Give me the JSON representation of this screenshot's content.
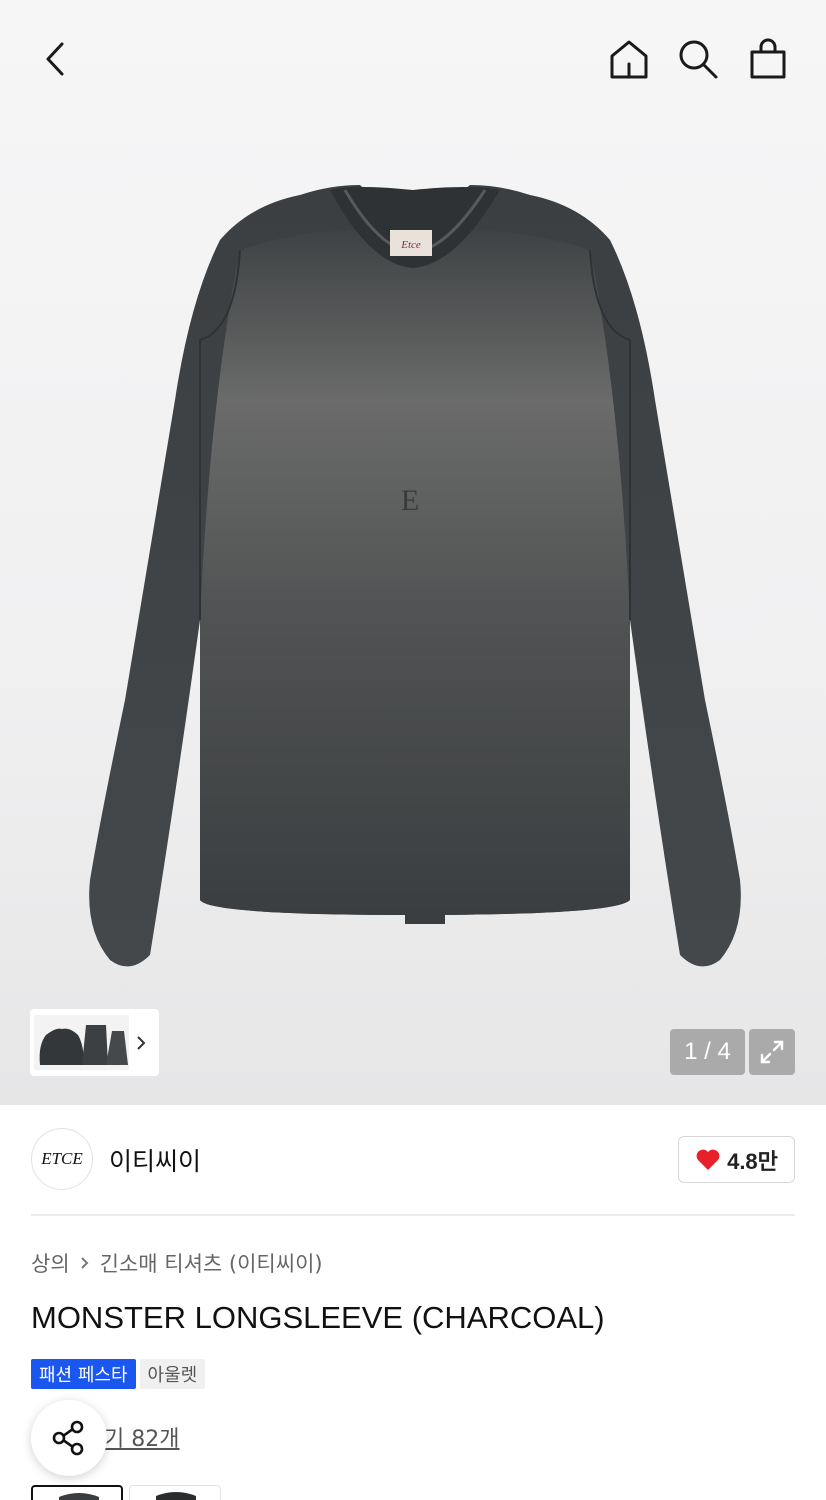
{
  "header": {
    "back_icon": "chevron-left-icon",
    "home_icon": "home-icon",
    "search_icon": "search-icon",
    "cart_icon": "shopping-bag-icon"
  },
  "gallery": {
    "current": "1",
    "total": "4",
    "counter_text": "1 / 4",
    "expand_icon": "expand-icon",
    "garment_color": "#4a4d4f"
  },
  "brand": {
    "logo_text": "ETCE",
    "name": "이티씨이",
    "like_count": "4.8만",
    "heart_color": "#e8202a"
  },
  "breadcrumb": {
    "level1": "상의",
    "level2": "긴소매 티셔츠 (이티씨이)"
  },
  "product": {
    "title": "MONSTER LONGSLEEVE (CHARCOAL)",
    "badge_festa": "패션 페스타",
    "badge_outlet": "아울렛",
    "review_text": "기 82개",
    "accent_color": "#1a56f0"
  }
}
